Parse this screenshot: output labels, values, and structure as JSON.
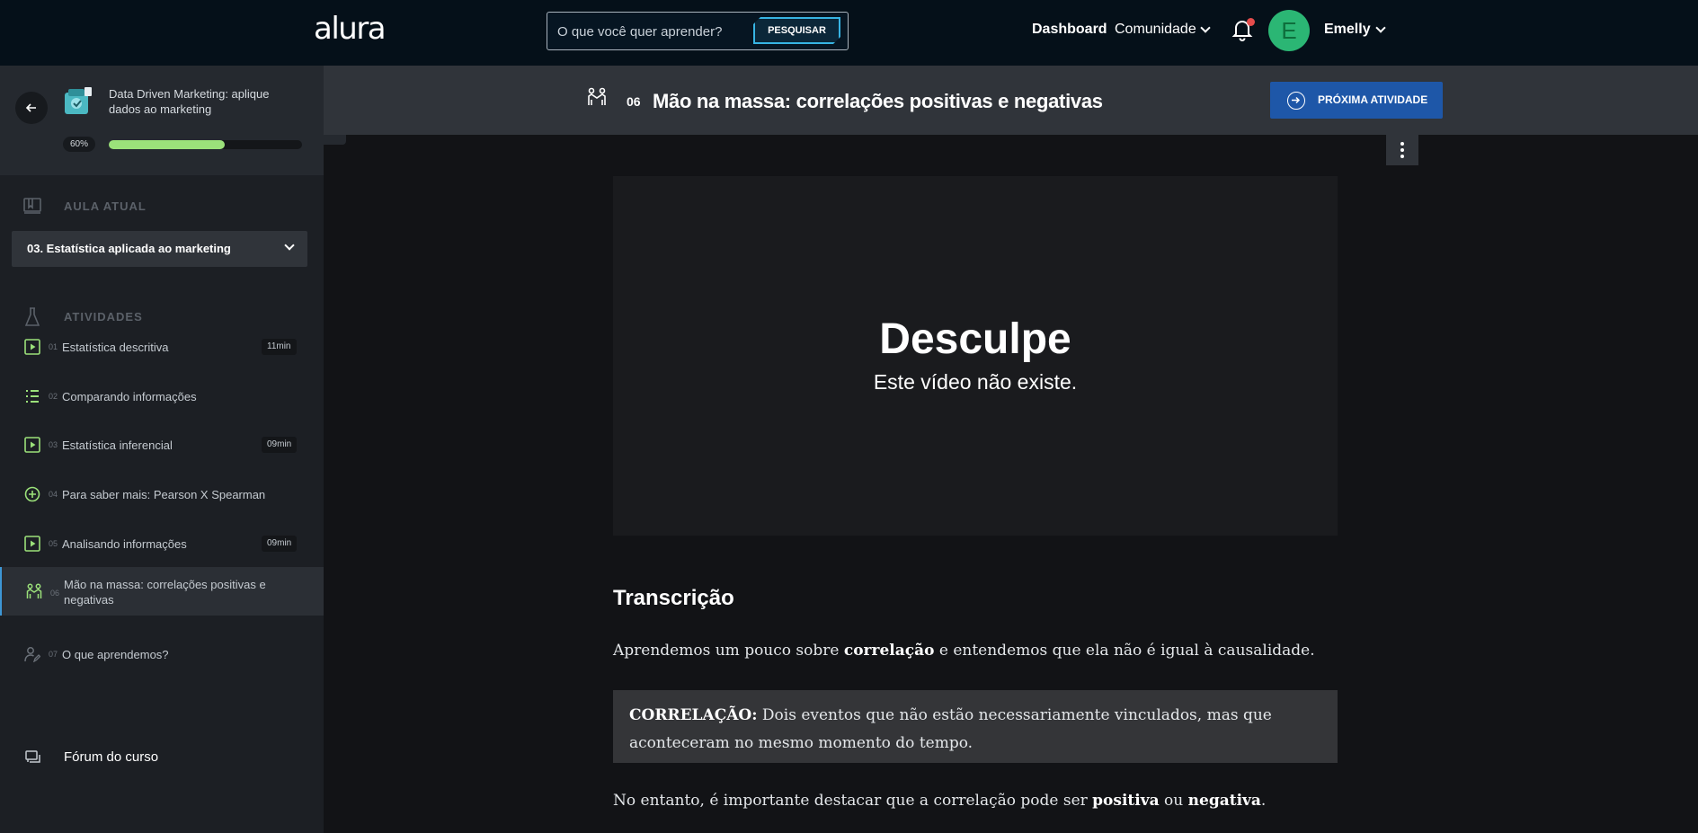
{
  "header": {
    "logo": "alura",
    "search_placeholder": "O que você quer aprender?",
    "search_button": "PESQUISAR",
    "nav_dashboard": "Dashboard",
    "nav_comunidade": "Comunidade",
    "avatar_letter": "E",
    "user_name": "Emelly"
  },
  "course": {
    "title": "Data Driven Marketing: aplique dados ao marketing",
    "progress_label": "60%",
    "progress_fraction": 0.6
  },
  "sidebar": {
    "aula_atual_label": "AULA ATUAL",
    "current_lesson": "03. Estatística aplicada ao marketing",
    "atividades_label": "ATIVIDADES",
    "activities": [
      {
        "num": "01",
        "label": "Estatística descritiva",
        "time": "11min",
        "icon": "video-icon"
      },
      {
        "num": "02",
        "label": "Comparando informações",
        "time": "",
        "icon": "list-icon"
      },
      {
        "num": "03",
        "label": "Estatística inferencial",
        "time": "09min",
        "icon": "video-icon"
      },
      {
        "num": "04",
        "label": "Para saber mais: Pearson X Spearman",
        "time": "",
        "icon": "plus-circle-icon"
      },
      {
        "num": "05",
        "label": "Analisando informações",
        "time": "09min",
        "icon": "video-icon"
      },
      {
        "num": "06",
        "label": "Mão na massa: correlações positivas e negativas",
        "time": "",
        "icon": "hands-on-icon"
      },
      {
        "num": "07",
        "label": "O que aprendemos?",
        "time": "",
        "icon": "user-edit-icon"
      }
    ],
    "forum_label": "Fórum do curso"
  },
  "activity": {
    "number": "06",
    "title": "Mão na massa: correlações positivas e negativas",
    "next_button": "PRÓXIMA ATIVIDADE"
  },
  "video": {
    "title": "Desculpe",
    "subtitle": "Este vídeo não existe."
  },
  "transcript": {
    "heading": "Transcrição",
    "p1_a": "Aprendemos um pouco sobre ",
    "p1_b": "correlação",
    "p1_c": " e entendemos que ela não é igual à causalidade.",
    "callout_term": "CORRELAÇÃO:",
    "callout_text": " Dois eventos que não estão necessariamente vinculados, mas que aconteceram no mesmo momento do tempo.",
    "p2_a": "No entanto, é importante destacar que a correlação pode ser ",
    "p2_b": "positiva",
    "p2_c": " ou ",
    "p2_d": "negativa",
    "p2_e": "."
  },
  "colors": {
    "accent_green": "#9be17a",
    "primary_blue": "#1e57a8",
    "avatar_green": "#2bb674"
  }
}
